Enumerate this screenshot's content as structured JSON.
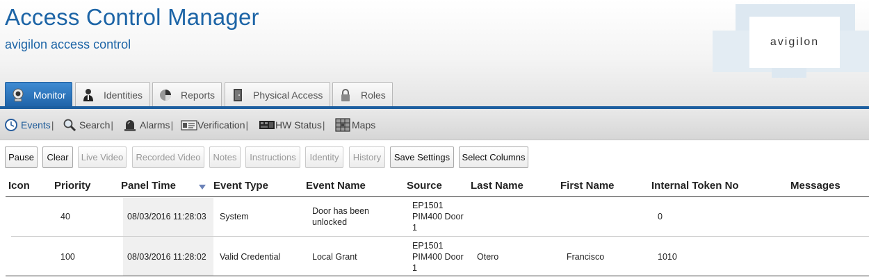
{
  "header": {
    "title": "Access Control Manager",
    "subtitle": "avigilon access control",
    "logo_text": "avigilon"
  },
  "tabs": [
    {
      "label": "Monitor",
      "icon": "webcam-icon",
      "active": true
    },
    {
      "label": "Identities",
      "icon": "person-icon",
      "active": false
    },
    {
      "label": "Reports",
      "icon": "pie-chart-icon",
      "active": false
    },
    {
      "label": "Physical Access",
      "icon": "door-icon",
      "active": false
    },
    {
      "label": "Roles",
      "icon": "lock-icon",
      "active": false
    }
  ],
  "subnav": [
    {
      "label": "Events",
      "icon": "clock-icon",
      "active": true
    },
    {
      "label": "Search",
      "icon": "magnifier-icon",
      "active": false
    },
    {
      "label": "Alarms",
      "icon": "siren-icon",
      "active": false
    },
    {
      "label": "Verification",
      "icon": "id-card-icon",
      "active": false
    },
    {
      "label": "HW Status",
      "icon": "hardware-icon",
      "active": false
    },
    {
      "label": "Maps",
      "icon": "map-icon",
      "active": false
    }
  ],
  "toolbar": {
    "pause": "Pause",
    "clear": "Clear",
    "live_video": "Live Video",
    "recorded_video": "Recorded Video",
    "notes": "Notes",
    "instructions": "Instructions",
    "identity": "Identity",
    "history": "History",
    "save_settings": "Save Settings",
    "select_columns": "Select Columns"
  },
  "table": {
    "columns": [
      "Icon",
      "Priority",
      "Panel Time",
      "Event Type",
      "Event Name",
      "Source",
      "Last Name",
      "First Name",
      "Internal Token No",
      "Messages"
    ],
    "sorted_column": "Panel Time",
    "rows": [
      {
        "priority": "40",
        "panel_time": "08/03/2016 11:28:03",
        "event_type": "System",
        "event_name_1": "Door has been",
        "event_name_2": "unlocked",
        "source_1": "EP1501",
        "source_2": "PIM400 Door",
        "source_3": "1",
        "last_name": "",
        "first_name": "",
        "token": "0",
        "messages": ""
      },
      {
        "priority": "100",
        "panel_time": "08/03/2016 11:28:02",
        "event_type": "Valid Credential",
        "event_name_1": "Local Grant",
        "event_name_2": "",
        "source_1": "EP1501",
        "source_2": "PIM400 Door",
        "source_3": "1",
        "last_name": "Otero",
        "first_name": "Francisco",
        "token": "1010",
        "messages": ""
      }
    ]
  }
}
